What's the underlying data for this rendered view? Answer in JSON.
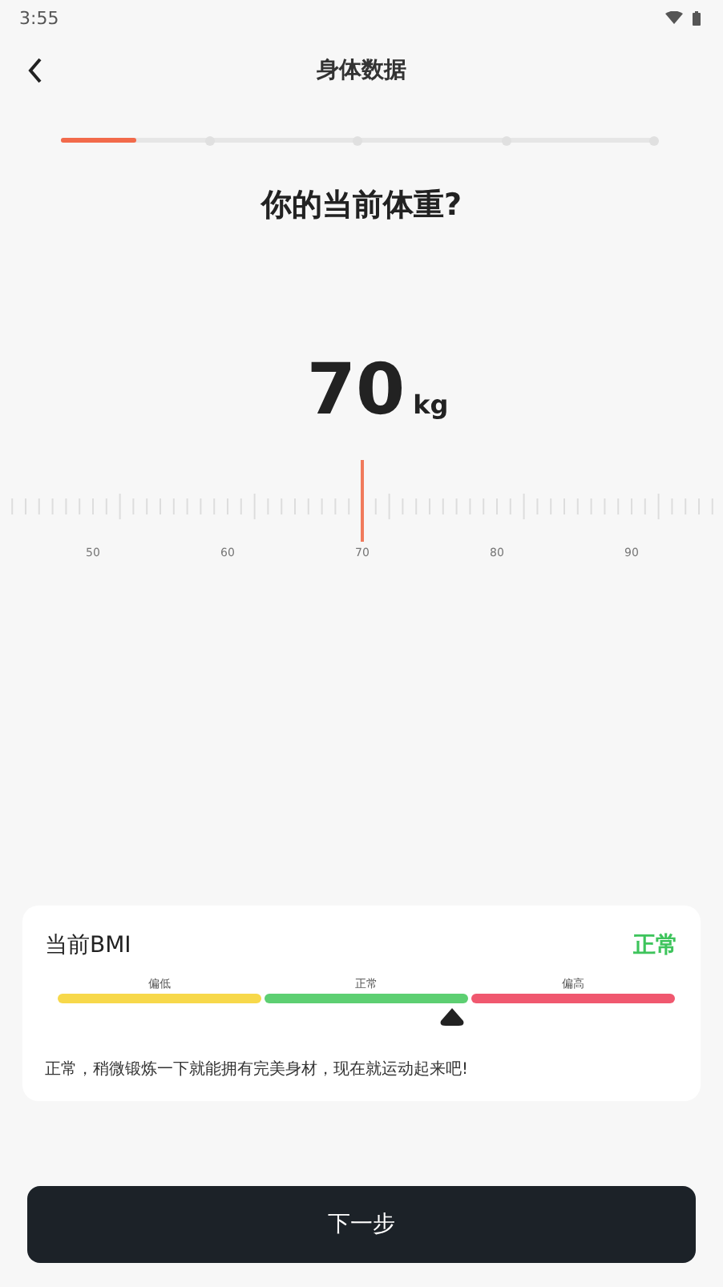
{
  "status_bar": {
    "time": "3:55"
  },
  "header": {
    "title": "身体数据"
  },
  "progress": {
    "level": 0.127
  },
  "question": "你的当前体重?",
  "weight": {
    "value": "70",
    "unit": "kg"
  },
  "ruler": {
    "labels": [
      "50",
      "60",
      "70",
      "80",
      "90"
    ]
  },
  "bmi": {
    "title": "当前BMI",
    "status": "正常",
    "level": 0.64,
    "segments": [
      {
        "label": "偏低",
        "color": "#f7d84a"
      },
      {
        "label": "正常",
        "color": "#5dcf72"
      },
      {
        "label": "偏高",
        "color": "#f0586f"
      }
    ],
    "message": "正常，稍微锻炼一下就能拥有完美身材，现在就运动起来吧!"
  },
  "next_button": "下一步"
}
